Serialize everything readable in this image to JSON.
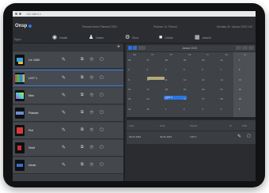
{
  "browser": {
    "url": "192.168.0.1"
  },
  "header": {
    "logo": "Onsp",
    "center_text": "Planned Items Planned 2020",
    "mid_text": "Planned 14. Plannd",
    "right_text": "Monday 30. Januar 2023 1:00"
  },
  "nav": {
    "left_label": "Eigen",
    "items": [
      {
        "label": "Inhalte",
        "icon": "disc-icon"
      },
      {
        "label": "Nutzer",
        "icon": "users-icon"
      },
      {
        "label": "Einst.",
        "icon": "settings-icon"
      },
      {
        "label": "Ordner",
        "icon": "folder-icon"
      },
      {
        "label": "Ansicht",
        "icon": "layout-icon"
      }
    ]
  },
  "playlist": {
    "add_label": "+",
    "rows": [
      {
        "name": "Ce 1080",
        "selected": false
      },
      {
        "name": "LIST 1",
        "selected": true
      },
      {
        "name": "Max",
        "selected": false
      },
      {
        "name": "Plakate",
        "selected": false
      },
      {
        "name": "Rot",
        "selected": false
      },
      {
        "name": "Start",
        "selected": false
      },
      {
        "name": "Inhalt",
        "selected": false
      }
    ],
    "row_icons": {
      "edit": "✎",
      "copy": "⧉",
      "clock": "◷",
      "delete": "▢"
    }
  },
  "calendar": {
    "title": "Januar 2023",
    "weekdays": [
      "Mo",
      "Di",
      "Mi",
      "Do",
      "Fr",
      "Sa",
      "So"
    ],
    "weeks": [
      [
        "26",
        "27",
        "28",
        "29",
        "30",
        "31",
        "1"
      ],
      [
        "2",
        "3",
        "4",
        "5",
        "6",
        "7",
        "8"
      ],
      [
        "9",
        "10",
        "11",
        "12",
        "13",
        "14",
        "15"
      ],
      [
        "16",
        "17",
        "18",
        "19",
        "20",
        "21",
        "22"
      ],
      [
        "23",
        "24",
        "25",
        "26",
        "27",
        "28",
        "29"
      ],
      [
        "30",
        "31",
        "1",
        "2",
        "3",
        "4",
        "5"
      ]
    ],
    "blue_event_label": "LIST 1",
    "colors": {
      "accent": "#2a76e3",
      "yellow_event": "#b4a97a"
    }
  },
  "events": {
    "headers": [
      "Start",
      "Ende",
      "Playlist",
      "Di",
      "Wdh."
    ],
    "row": [
      "30.01.2023",
      "30.01.2023",
      "LIST 1"
    ]
  }
}
